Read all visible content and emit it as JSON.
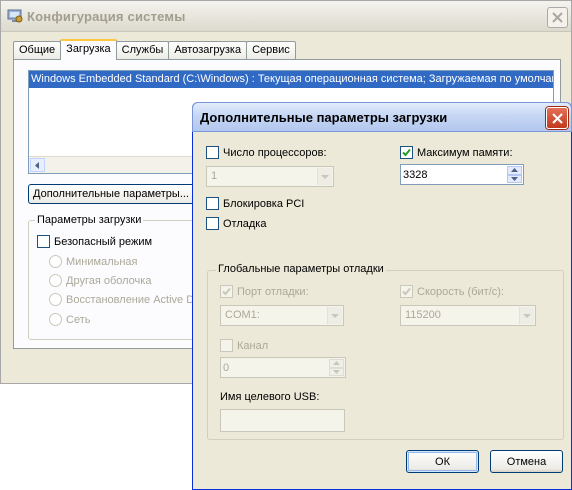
{
  "back_window": {
    "title": "Конфигурация системы",
    "tabs": [
      {
        "label": "Общие"
      },
      {
        "label": "Загрузка"
      },
      {
        "label": "Службы"
      },
      {
        "label": "Автозагрузка"
      },
      {
        "label": "Сервис"
      }
    ],
    "active_tab": "Загрузка",
    "boot_entry": "Windows Embedded Standard (C:\\Windows) : Текущая операционная система; Загружаемая по умолчанию",
    "advanced_button": "Дополнительные параметры...",
    "boot_options": {
      "legend": "Параметры загрузки",
      "safe_mode_label": "Безопасный режим",
      "safe_mode_checked": false,
      "radios": [
        {
          "label": "Минимальная"
        },
        {
          "label": "Другая оболочка"
        },
        {
          "label": "Восстановление Active Dir"
        },
        {
          "label": "Сеть"
        }
      ]
    }
  },
  "dialog": {
    "title": "Дополнительные параметры загрузки",
    "num_processors": {
      "label": "Число процессоров:",
      "checked": false,
      "value": "1"
    },
    "max_memory": {
      "label": "Максимум памяти:",
      "checked": true,
      "value": "3328"
    },
    "pci_lock": {
      "label": "Блокировка PCI",
      "checked": false
    },
    "debug": {
      "label": "Отладка",
      "checked": false
    },
    "global_debug": {
      "legend": "Глобальные параметры отладки",
      "debug_port": {
        "label": "Порт отладки:",
        "checked": true,
        "value": "COM1:"
      },
      "baud_rate": {
        "label": "Скорость (бит/с):",
        "checked": true,
        "value": "115200"
      },
      "channel": {
        "label": "Канал",
        "checked": false,
        "value": "0"
      },
      "usb_target": {
        "label": "Имя целевого USB:",
        "value": ""
      }
    },
    "ok_label": "ОК",
    "cancel_label": "Отмена"
  },
  "colors": {
    "selection": "#316ac5",
    "dialog_border": "#0831d9",
    "checkbox_check": "#21a121",
    "close_red": "#c1391c"
  }
}
